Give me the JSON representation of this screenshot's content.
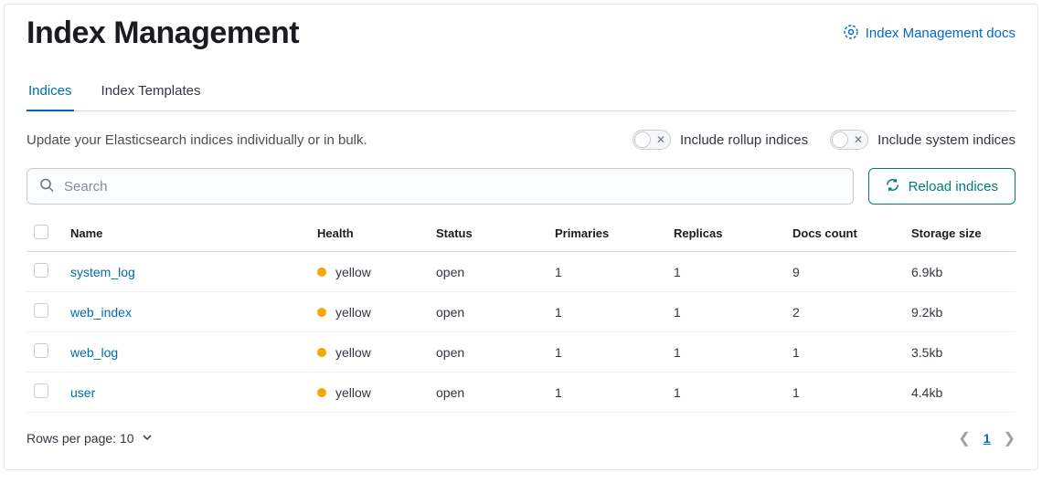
{
  "header": {
    "title": "Index Management",
    "docs_link": "Index Management docs"
  },
  "tabs": [
    {
      "label": "Indices",
      "active": true
    },
    {
      "label": "Index Templates",
      "active": false
    }
  ],
  "filter_text": "Update your Elasticsearch indices individually or in bulk.",
  "toggles": {
    "rollup": "Include rollup indices",
    "system": "Include system indices"
  },
  "search": {
    "placeholder": "Search"
  },
  "reload_label": "Reload indices",
  "columns": {
    "name": "Name",
    "health": "Health",
    "status": "Status",
    "primaries": "Primaries",
    "replicas": "Replicas",
    "docs": "Docs count",
    "storage": "Storage size"
  },
  "rows": [
    {
      "name": "system_log",
      "health": "yellow",
      "status": "open",
      "primaries": "1",
      "replicas": "1",
      "docs": "9",
      "storage": "6.9kb"
    },
    {
      "name": "web_index",
      "health": "yellow",
      "status": "open",
      "primaries": "1",
      "replicas": "1",
      "docs": "2",
      "storage": "9.2kb"
    },
    {
      "name": "web_log",
      "health": "yellow",
      "status": "open",
      "primaries": "1",
      "replicas": "1",
      "docs": "1",
      "storage": "3.5kb"
    },
    {
      "name": "user",
      "health": "yellow",
      "status": "open",
      "primaries": "1",
      "replicas": "1",
      "docs": "1",
      "storage": "4.4kb"
    }
  ],
  "footer": {
    "rows_per_page_label": "Rows per page: 10",
    "current_page": "1"
  }
}
